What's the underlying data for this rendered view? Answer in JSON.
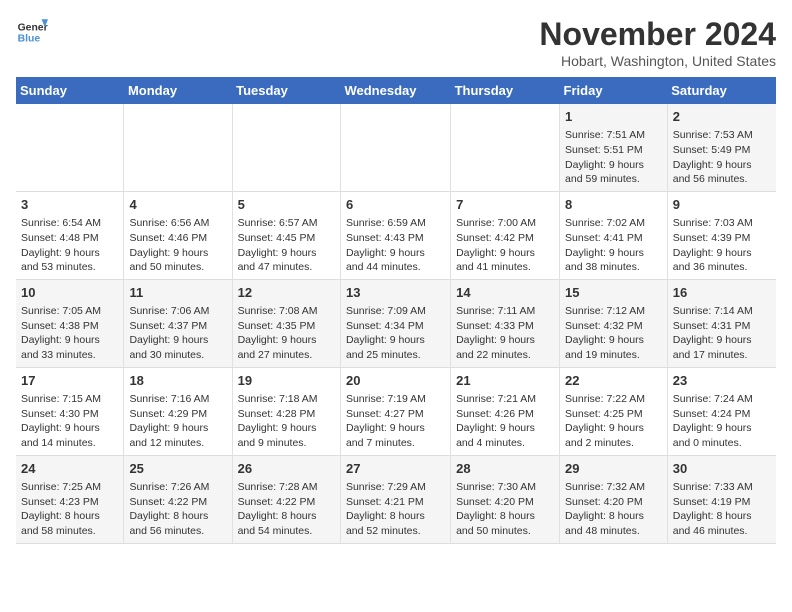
{
  "logo": {
    "line1": "General",
    "line2": "Blue"
  },
  "title": "November 2024",
  "location": "Hobart, Washington, United States",
  "headers": [
    "Sunday",
    "Monday",
    "Tuesday",
    "Wednesday",
    "Thursday",
    "Friday",
    "Saturday"
  ],
  "weeks": [
    [
      {
        "day": "",
        "info": ""
      },
      {
        "day": "",
        "info": ""
      },
      {
        "day": "",
        "info": ""
      },
      {
        "day": "",
        "info": ""
      },
      {
        "day": "",
        "info": ""
      },
      {
        "day": "1",
        "info": "Sunrise: 7:51 AM\nSunset: 5:51 PM\nDaylight: 9 hours and 59 minutes."
      },
      {
        "day": "2",
        "info": "Sunrise: 7:53 AM\nSunset: 5:49 PM\nDaylight: 9 hours and 56 minutes."
      }
    ],
    [
      {
        "day": "3",
        "info": "Sunrise: 6:54 AM\nSunset: 4:48 PM\nDaylight: 9 hours and 53 minutes."
      },
      {
        "day": "4",
        "info": "Sunrise: 6:56 AM\nSunset: 4:46 PM\nDaylight: 9 hours and 50 minutes."
      },
      {
        "day": "5",
        "info": "Sunrise: 6:57 AM\nSunset: 4:45 PM\nDaylight: 9 hours and 47 minutes."
      },
      {
        "day": "6",
        "info": "Sunrise: 6:59 AM\nSunset: 4:43 PM\nDaylight: 9 hours and 44 minutes."
      },
      {
        "day": "7",
        "info": "Sunrise: 7:00 AM\nSunset: 4:42 PM\nDaylight: 9 hours and 41 minutes."
      },
      {
        "day": "8",
        "info": "Sunrise: 7:02 AM\nSunset: 4:41 PM\nDaylight: 9 hours and 38 minutes."
      },
      {
        "day": "9",
        "info": "Sunrise: 7:03 AM\nSunset: 4:39 PM\nDaylight: 9 hours and 36 minutes."
      }
    ],
    [
      {
        "day": "10",
        "info": "Sunrise: 7:05 AM\nSunset: 4:38 PM\nDaylight: 9 hours and 33 minutes."
      },
      {
        "day": "11",
        "info": "Sunrise: 7:06 AM\nSunset: 4:37 PM\nDaylight: 9 hours and 30 minutes."
      },
      {
        "day": "12",
        "info": "Sunrise: 7:08 AM\nSunset: 4:35 PM\nDaylight: 9 hours and 27 minutes."
      },
      {
        "day": "13",
        "info": "Sunrise: 7:09 AM\nSunset: 4:34 PM\nDaylight: 9 hours and 25 minutes."
      },
      {
        "day": "14",
        "info": "Sunrise: 7:11 AM\nSunset: 4:33 PM\nDaylight: 9 hours and 22 minutes."
      },
      {
        "day": "15",
        "info": "Sunrise: 7:12 AM\nSunset: 4:32 PM\nDaylight: 9 hours and 19 minutes."
      },
      {
        "day": "16",
        "info": "Sunrise: 7:14 AM\nSunset: 4:31 PM\nDaylight: 9 hours and 17 minutes."
      }
    ],
    [
      {
        "day": "17",
        "info": "Sunrise: 7:15 AM\nSunset: 4:30 PM\nDaylight: 9 hours and 14 minutes."
      },
      {
        "day": "18",
        "info": "Sunrise: 7:16 AM\nSunset: 4:29 PM\nDaylight: 9 hours and 12 minutes."
      },
      {
        "day": "19",
        "info": "Sunrise: 7:18 AM\nSunset: 4:28 PM\nDaylight: 9 hours and 9 minutes."
      },
      {
        "day": "20",
        "info": "Sunrise: 7:19 AM\nSunset: 4:27 PM\nDaylight: 9 hours and 7 minutes."
      },
      {
        "day": "21",
        "info": "Sunrise: 7:21 AM\nSunset: 4:26 PM\nDaylight: 9 hours and 4 minutes."
      },
      {
        "day": "22",
        "info": "Sunrise: 7:22 AM\nSunset: 4:25 PM\nDaylight: 9 hours and 2 minutes."
      },
      {
        "day": "23",
        "info": "Sunrise: 7:24 AM\nSunset: 4:24 PM\nDaylight: 9 hours and 0 minutes."
      }
    ],
    [
      {
        "day": "24",
        "info": "Sunrise: 7:25 AM\nSunset: 4:23 PM\nDaylight: 8 hours and 58 minutes."
      },
      {
        "day": "25",
        "info": "Sunrise: 7:26 AM\nSunset: 4:22 PM\nDaylight: 8 hours and 56 minutes."
      },
      {
        "day": "26",
        "info": "Sunrise: 7:28 AM\nSunset: 4:22 PM\nDaylight: 8 hours and 54 minutes."
      },
      {
        "day": "27",
        "info": "Sunrise: 7:29 AM\nSunset: 4:21 PM\nDaylight: 8 hours and 52 minutes."
      },
      {
        "day": "28",
        "info": "Sunrise: 7:30 AM\nSunset: 4:20 PM\nDaylight: 8 hours and 50 minutes."
      },
      {
        "day": "29",
        "info": "Sunrise: 7:32 AM\nSunset: 4:20 PM\nDaylight: 8 hours and 48 minutes."
      },
      {
        "day": "30",
        "info": "Sunrise: 7:33 AM\nSunset: 4:19 PM\nDaylight: 8 hours and 46 minutes."
      }
    ]
  ]
}
